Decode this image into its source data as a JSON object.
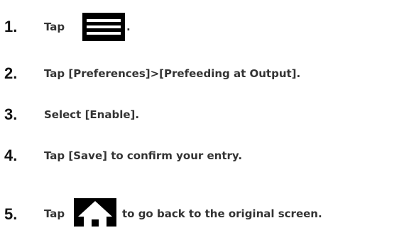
{
  "steps": [
    {
      "number": "1.",
      "before": "Tap",
      "icon": "menu-icon",
      "after": "."
    },
    {
      "number": "2.",
      "text": "Tap [Preferences]>[Prefeeding at Output]."
    },
    {
      "number": "3.",
      "text": "Select [Enable]."
    },
    {
      "number": "4.",
      "text": "Tap [Save] to confirm your entry."
    },
    {
      "number": "5.",
      "before": "Tap",
      "icon": "home-icon",
      "after": "to go back to the original screen."
    }
  ],
  "colors": {
    "icon_background": "#000000",
    "icon_foreground": "#ffffff",
    "text": "#333333"
  }
}
